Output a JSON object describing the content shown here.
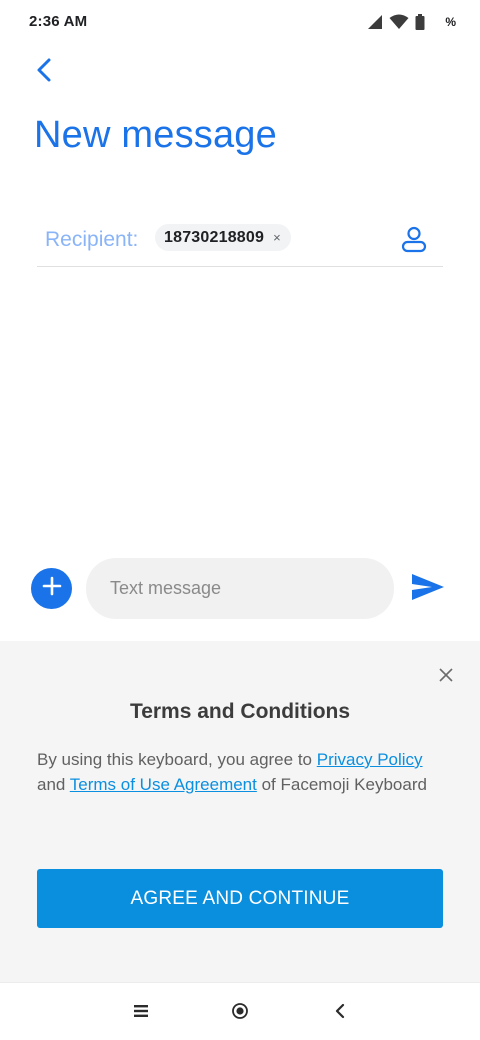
{
  "status_bar": {
    "time": "2:36 AM",
    "icons": [
      "signal-icon",
      "wifi-icon",
      "battery-icon"
    ],
    "battery_text": "%"
  },
  "header": {
    "back_icon": "back-arrow-icon",
    "title": "New message"
  },
  "recipient": {
    "label": "Recipient:",
    "chips": [
      {
        "text": "18730218809",
        "remove_glyph": "×"
      }
    ],
    "contact_icon": "person-icon"
  },
  "composer": {
    "add_icon": "plus-icon",
    "placeholder": "Text message",
    "value": "",
    "send_icon": "send-icon"
  },
  "terms": {
    "close_icon": "close-icon",
    "title": "Terms and Conditions",
    "body_prefix": "By using this keyboard, you agree to ",
    "privacy_link": "Privacy Policy",
    "body_middle": " and ",
    "terms_link": "Terms of Use Agreement",
    "body_suffix": " of Facemoji Keyboard",
    "agree_label": "AGREE AND CONTINUE"
  },
  "nav_bar": {
    "icons": [
      "recents-icon",
      "home-icon",
      "back-icon"
    ]
  },
  "colors": {
    "accent": "#1a73e8",
    "label_light": "#8ab4f8",
    "link": "#0b8fe0",
    "agree_button": "#0a8fde",
    "panel_bg": "#f5f5f5"
  }
}
